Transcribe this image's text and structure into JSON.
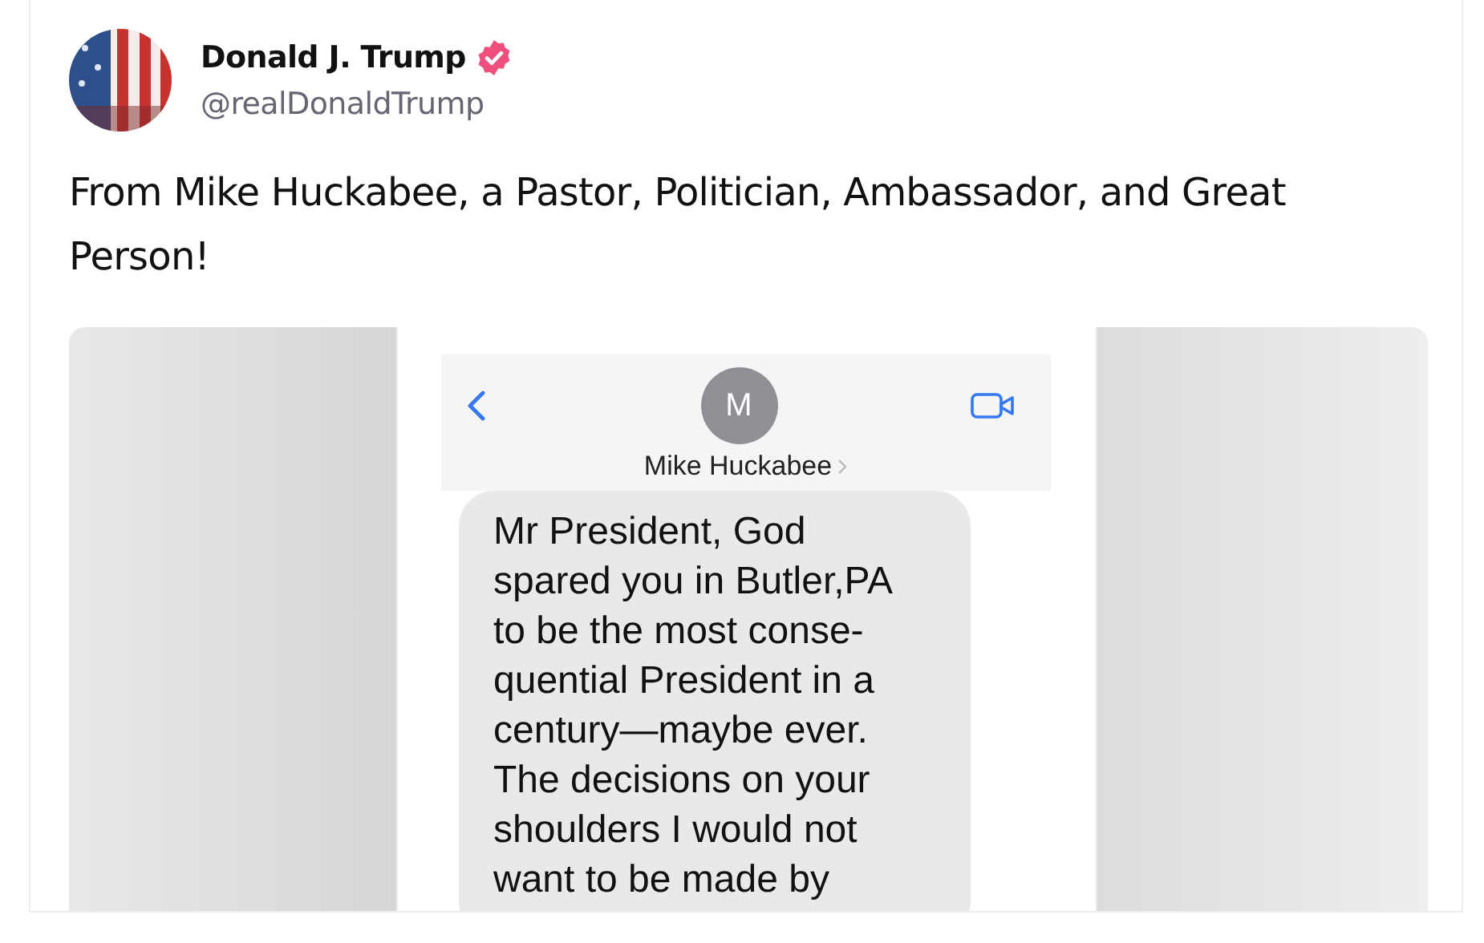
{
  "post": {
    "author": {
      "name": "Donald J. Trump",
      "verified": true,
      "handle": "@realDonaldTrump"
    },
    "text": "From Mike Huckabee, a Pastor, Politician, Ambassador, and Great Person!",
    "media": {
      "kind": "screenshot",
      "contact": {
        "initial": "M",
        "name": "Mike Huckabee"
      },
      "message": "Mr President, God\nspared you in Butler,PA\nto be the most conse-\nquential President in a\ncentury—maybe ever.\nThe decisions on your\nshoulders I would not\nwant to be made by"
    }
  }
}
